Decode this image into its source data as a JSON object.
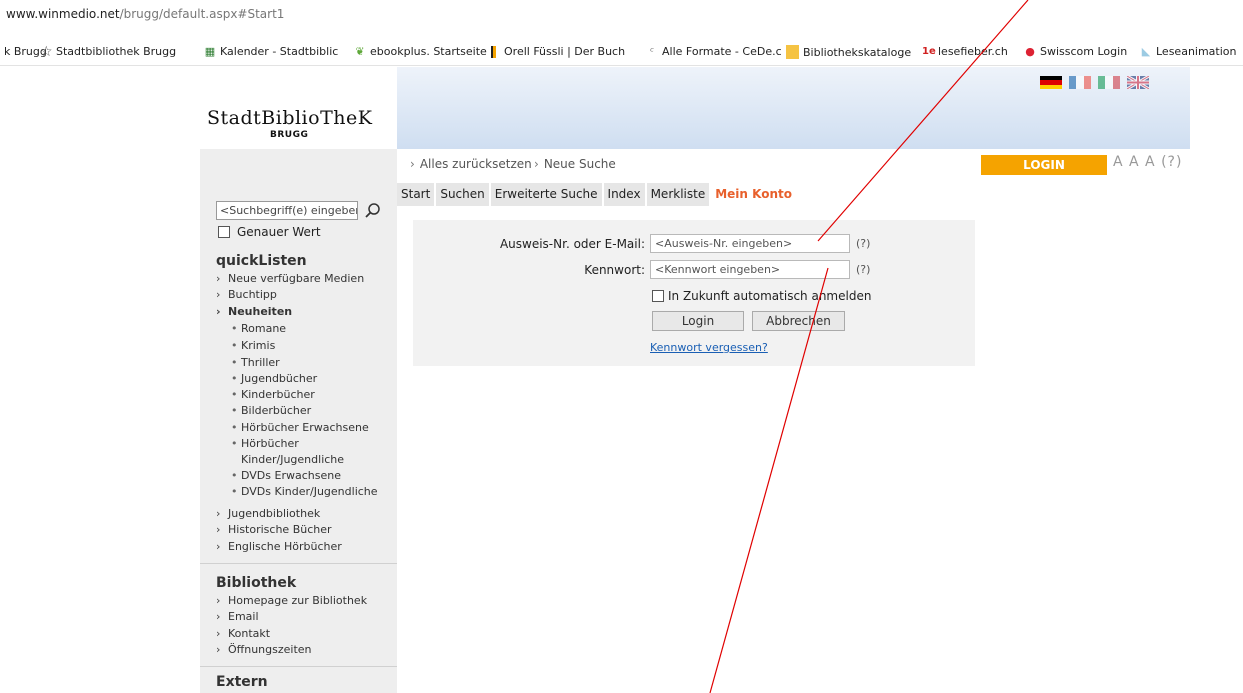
{
  "browser": {
    "url_host": "www.winmedio.net",
    "url_path": "/brugg/default.aspx#Start1",
    "bookmarks": [
      {
        "icon": "partial",
        "label": "k Brugg"
      },
      {
        "icon": "star",
        "label": "Stadtbibliothek Brugg"
      },
      {
        "icon": "calendar",
        "label": "Kalender - Stadtbiblic"
      },
      {
        "icon": "leaf",
        "label": "ebookplus. Startseite"
      },
      {
        "icon": "of",
        "label": "Orell Füssli | Der Buch"
      },
      {
        "icon": "cede",
        "label": "Alle Formate - CeDe.c"
      },
      {
        "icon": "folder",
        "label": "Bibliothekskataloge"
      },
      {
        "icon": "le",
        "label": "lesefieber.ch"
      },
      {
        "icon": "swisscom",
        "label": "Swisscom Login"
      },
      {
        "icon": "leseanimation",
        "label": "Leseanimation"
      }
    ]
  },
  "site": {
    "logo": "StadtBiblioTheK",
    "logo_sub": "BRUGG",
    "breadcrumb": [
      {
        "label": "Alles zurücksetzen"
      },
      {
        "label": "Neue Suche"
      }
    ],
    "login_label": "LOGIN",
    "font_size_controls": "A A A (?)",
    "tabs": [
      {
        "label": "Start",
        "active": false
      },
      {
        "label": "Suchen",
        "active": false
      },
      {
        "label": "Erweiterte Suche",
        "active": false
      },
      {
        "label": "Index",
        "active": false
      },
      {
        "label": "Merkliste",
        "active": false
      },
      {
        "label": "Mein Konto",
        "active": true
      }
    ]
  },
  "login_form": {
    "id_label": "Ausweis-Nr. oder E-Mail:",
    "id_placeholder": "<Ausweis-Nr. eingeben>",
    "pw_label": "Kennwort:",
    "pw_placeholder": "<Kennwort eingeben>",
    "help": "(?)",
    "remember_label": "In Zukunft automatisch anmelden",
    "login_button": "Login",
    "cancel_button": "Abbrechen",
    "forgot_link": "Kennwort vergessen?"
  },
  "sidebar": {
    "search_placeholder": "<Suchbegriff(e) eingeben>",
    "exact_label": "Genauer Wert",
    "quicklisten_title": "quickListen",
    "quicklisten_items": [
      "Neue verfügbare Medien",
      "Buchtipp"
    ],
    "neuheiten_label": "Neuheiten",
    "neuheiten_items": [
      "Romane",
      "Krimis",
      "Thriller",
      "Jugendbücher",
      "Kinderbücher",
      "Bilderbücher",
      "Hörbücher Erwachsene",
      "Hörbücher",
      "Kinder/Jugendliche",
      "DVDs Erwachsene",
      "DVDs Kinder/Jugendliche"
    ],
    "more_items": [
      "Jugendbibliothek",
      "Historische Bücher",
      "Englische Hörbücher"
    ],
    "bibliothek_title": "Bibliothek",
    "bibliothek_items": [
      "Homepage zur Bibliothek",
      "Email",
      "Kontakt",
      "Öffnungszeiten"
    ],
    "extern_title": "Extern"
  },
  "colors": {
    "accent_orange": "#f5a300",
    "active_tab": "#e8602c",
    "annotation_red": "#e00000"
  }
}
